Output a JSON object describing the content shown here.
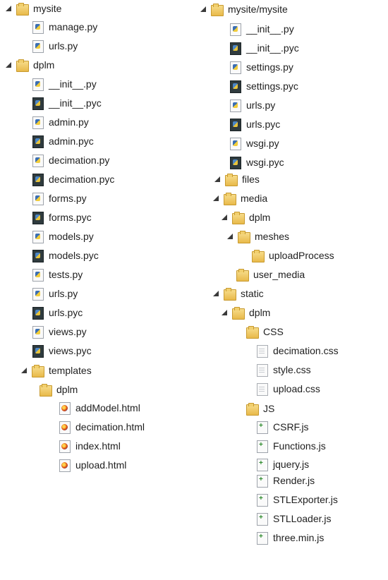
{
  "left_tree": [
    {
      "label": "mysite",
      "icon": "folder-icon",
      "expanded": true,
      "depth": 0
    },
    {
      "label": "manage.py",
      "icon": "python-file-icon",
      "depth": 1
    },
    {
      "label": "urls.py",
      "icon": "python-file-icon",
      "depth": 1
    },
    {
      "label": "dplm",
      "icon": "folder-icon",
      "expanded": true,
      "depth": 1
    },
    {
      "label": "__init__.py",
      "icon": "python-file-icon",
      "depth": 2
    },
    {
      "label": "__init__.pyc",
      "icon": "compiled-python-icon",
      "depth": 2
    },
    {
      "label": "admin.py",
      "icon": "python-file-icon",
      "depth": 2
    },
    {
      "label": "admin.pyc",
      "icon": "compiled-python-icon",
      "depth": 2
    },
    {
      "label": "decimation.py",
      "icon": "python-file-icon",
      "depth": 2
    },
    {
      "label": "decimation.pyc",
      "icon": "compiled-python-icon",
      "depth": 2
    },
    {
      "label": "forms.py",
      "icon": "python-file-icon",
      "depth": 2
    },
    {
      "label": "forms.pyc",
      "icon": "compiled-python-icon",
      "depth": 2
    },
    {
      "label": "models.py",
      "icon": "python-file-icon",
      "depth": 2
    },
    {
      "label": "models.pyc",
      "icon": "compiled-python-icon",
      "depth": 2
    },
    {
      "label": "tests.py",
      "icon": "python-file-icon",
      "depth": 2
    },
    {
      "label": "urls.py",
      "icon": "python-file-icon",
      "depth": 2
    },
    {
      "label": "urls.pyc",
      "icon": "compiled-python-icon",
      "depth": 2
    },
    {
      "label": "views.py",
      "icon": "python-file-icon",
      "depth": 2
    },
    {
      "label": "views.pyc",
      "icon": "compiled-python-icon",
      "depth": 2
    },
    {
      "label": "templates",
      "icon": "folder-icon",
      "expanded": true,
      "depth": 2
    },
    {
      "label": "dplm",
      "icon": "folder-icon",
      "depth": 3
    },
    {
      "label": "addModel.html",
      "icon": "html-file-icon",
      "depth": 4
    },
    {
      "label": "decimation.html",
      "icon": "html-file-icon",
      "depth": 4
    },
    {
      "label": "index.html",
      "icon": "html-file-icon",
      "depth": 4
    },
    {
      "label": "upload.html",
      "icon": "html-file-icon",
      "depth": 4
    }
  ],
  "right_tree": [
    {
      "label": "mysite/mysite",
      "icon": "folder-icon",
      "expanded": true,
      "depth": 0
    },
    {
      "label": "__init__.py",
      "icon": "python-file-icon",
      "depth": 1
    },
    {
      "label": "__init__.pyc",
      "icon": "compiled-python-icon",
      "depth": 1
    },
    {
      "label": "settings.py",
      "icon": "python-file-icon",
      "depth": 1
    },
    {
      "label": "settings.pyc",
      "icon": "compiled-python-icon",
      "depth": 1
    },
    {
      "label": "urls.py",
      "icon": "python-file-icon",
      "depth": 1
    },
    {
      "label": "urls.pyc",
      "icon": "compiled-python-icon",
      "depth": 1
    },
    {
      "label": "wsgi.py",
      "icon": "python-file-icon",
      "depth": 1
    },
    {
      "label": "wsgi.pyc",
      "icon": "compiled-python-icon",
      "depth": 1
    },
    {
      "label": "files",
      "icon": "folder-icon",
      "expanded": true,
      "depth": 0
    },
    {
      "label": "media",
      "icon": "folder-icon",
      "expanded": true,
      "depth": 1
    },
    {
      "label": "dplm",
      "icon": "folder-icon",
      "expanded": true,
      "depth": 2
    },
    {
      "label": "meshes",
      "icon": "folder-icon",
      "expanded": true,
      "depth": 3
    },
    {
      "label": "uploadProcess",
      "icon": "folder-icon",
      "depth": 4
    },
    {
      "label": "user_media",
      "icon": "folder-icon",
      "depth": 2
    },
    {
      "label": "static",
      "icon": "folder-icon",
      "expanded": true,
      "depth": 1
    },
    {
      "label": "dplm",
      "icon": "folder-icon",
      "expanded": true,
      "depth": 2
    },
    {
      "label": "CSS",
      "icon": "folder-icon",
      "depth": 3
    },
    {
      "label": "decimation.css",
      "icon": "css-file-icon",
      "depth": 4
    },
    {
      "label": "style.css",
      "icon": "css-file-icon",
      "depth": 4
    },
    {
      "label": "upload.css",
      "icon": "css-file-icon",
      "depth": 4
    },
    {
      "label": "JS",
      "icon": "folder-icon",
      "depth": 3
    },
    {
      "label": "CSRF.js",
      "icon": "js-file-icon",
      "depth": 4
    },
    {
      "label": "Functions.js",
      "icon": "js-file-icon",
      "depth": 4
    },
    {
      "label": "jquery.js",
      "icon": "js-file-icon",
      "depth": 4
    },
    {
      "label": "Render.js",
      "icon": "js-file-icon",
      "depth": 4
    },
    {
      "label": "STLExporter.js",
      "icon": "js-file-icon",
      "depth": 4
    },
    {
      "label": "STLLoader.js",
      "icon": "js-file-icon",
      "depth": 4
    },
    {
      "label": "three.min.js",
      "icon": "js-file-icon",
      "depth": 4
    }
  ]
}
